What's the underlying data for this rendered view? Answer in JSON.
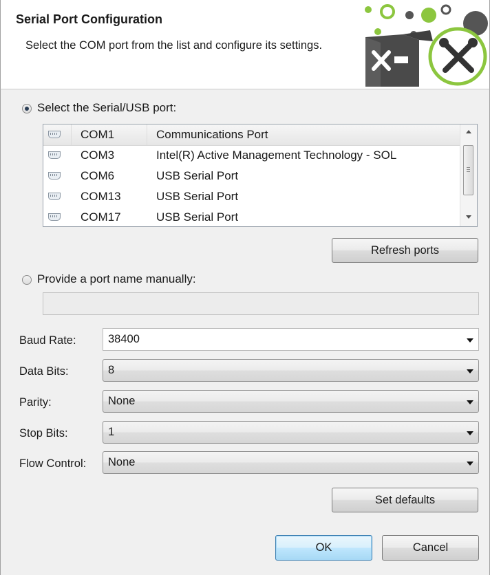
{
  "header": {
    "title": "Serial Port Configuration",
    "description": "Select the COM port from the list and configure its settings."
  },
  "select_port": {
    "label": "Select the Serial/USB port:",
    "selected": true
  },
  "port_table": {
    "rows": [
      {
        "icon": "serial-port-icon",
        "port": "COM1",
        "description": "Communications Port"
      },
      {
        "icon": "serial-port-icon",
        "port": "COM3",
        "description": "Intel(R) Active Management Technology - SOL"
      },
      {
        "icon": "serial-port-icon",
        "port": "COM6",
        "description": "USB Serial Port"
      },
      {
        "icon": "serial-port-icon",
        "port": "COM13",
        "description": "USB Serial Port"
      },
      {
        "icon": "serial-port-icon",
        "port": "COM17",
        "description": "USB Serial Port"
      }
    ]
  },
  "refresh_button": "Refresh ports",
  "manual_port": {
    "label": "Provide a port name manually:",
    "selected": false,
    "value": ""
  },
  "settings": {
    "baud_rate": {
      "label": "Baud Rate:",
      "value": "38400"
    },
    "data_bits": {
      "label": "Data Bits:",
      "value": "8"
    },
    "parity": {
      "label": "Parity:",
      "value": "None"
    },
    "stop_bits": {
      "label": "Stop Bits:",
      "value": "1"
    },
    "flow_control": {
      "label": "Flow Control:",
      "value": "None"
    }
  },
  "set_defaults_button": "Set defaults",
  "ok_button": "OK",
  "cancel_button": "Cancel",
  "colors": {
    "logo_green": "#8cc63f",
    "logo_dark": "#4a4a4a",
    "selected_radio": "#2a3d55",
    "default_button_border": "#3c7fb1"
  }
}
